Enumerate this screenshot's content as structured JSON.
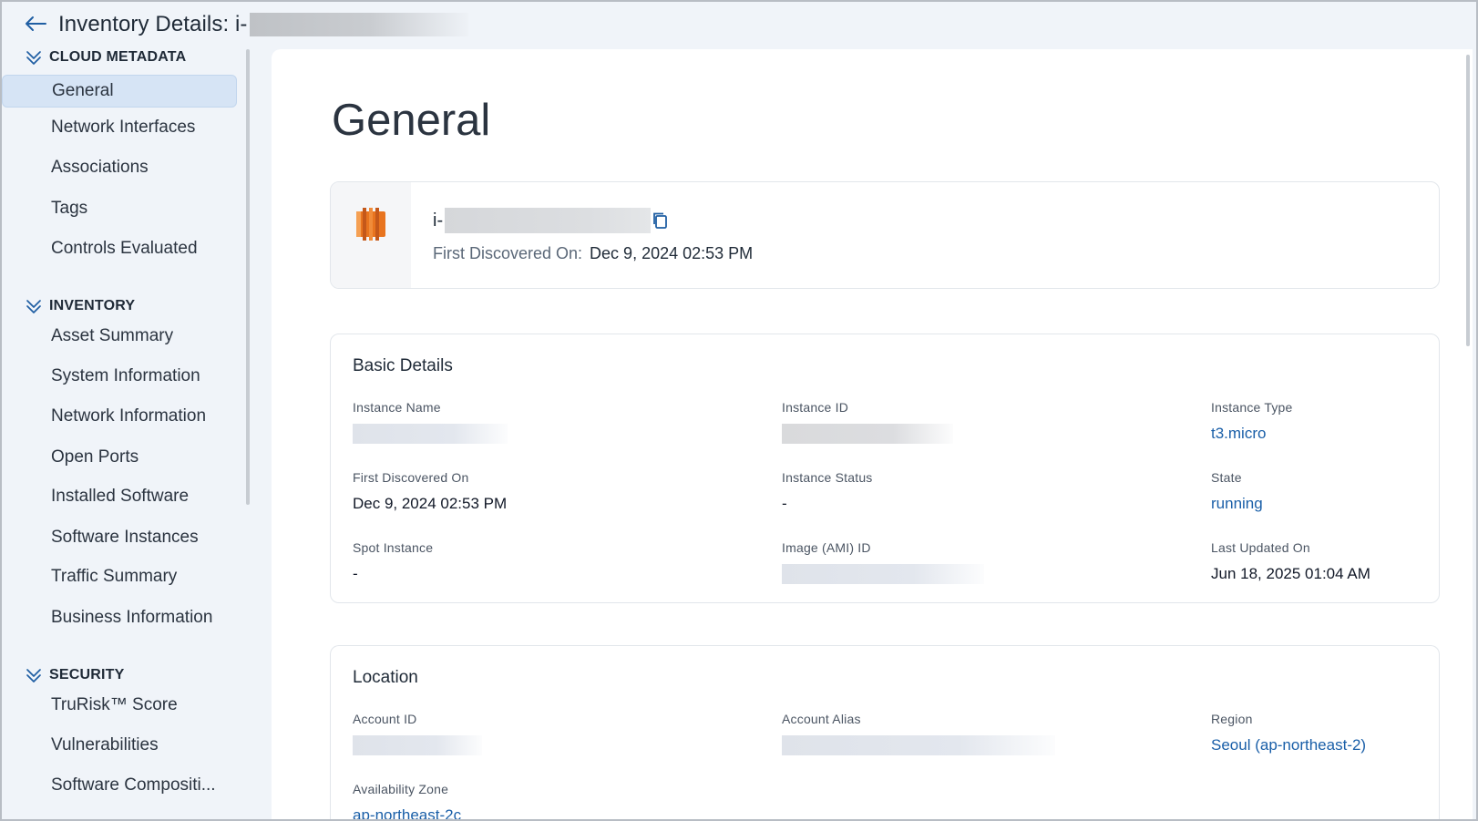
{
  "header": {
    "title": "Inventory Details: i-"
  },
  "sidebar": {
    "sections": [
      {
        "heading": "CLOUD METADATA",
        "items": [
          "General",
          "Network Interfaces",
          "Associations",
          "Tags",
          "Controls Evaluated"
        ]
      },
      {
        "heading": "INVENTORY",
        "items": [
          "Asset Summary",
          "System Information",
          "Network Information",
          "Open Ports",
          "Installed Software",
          "Software Instances",
          "Traffic Summary",
          "Business Information"
        ]
      },
      {
        "heading": "SECURITY",
        "items": [
          "TruRisk™ Score",
          "Vulnerabilities",
          "Software Compositi..."
        ]
      }
    ],
    "active_item": "General"
  },
  "main": {
    "title": "General",
    "instance_card": {
      "instance_prefix": "i-",
      "first_discovered_label": "First Discovered On:",
      "first_discovered_value": "Dec 9, 2024 02:53 PM"
    },
    "basic_details": {
      "title": "Basic Details",
      "fields": {
        "instance_name": {
          "label": "Instance Name",
          "value": ""
        },
        "instance_id": {
          "label": "Instance ID",
          "value": ""
        },
        "instance_type": {
          "label": "Instance Type",
          "value": "t3.micro"
        },
        "first_discovered": {
          "label": "First Discovered On",
          "value": "Dec 9, 2024 02:53 PM"
        },
        "instance_status": {
          "label": "Instance Status",
          "value": "-"
        },
        "state": {
          "label": "State",
          "value": "running"
        },
        "spot_instance": {
          "label": "Spot Instance",
          "value": "-"
        },
        "image_id": {
          "label": "Image (AMI) ID",
          "value": ""
        },
        "last_updated": {
          "label": "Last Updated On",
          "value": "Jun 18, 2025 01:04 AM"
        }
      }
    },
    "location": {
      "title": "Location",
      "fields": {
        "account_id": {
          "label": "Account ID",
          "value": ""
        },
        "account_alias": {
          "label": "Account Alias",
          "value": ""
        },
        "region": {
          "label": "Region",
          "value": "Seoul (ap-northeast-2)"
        },
        "availability_zone": {
          "label": "Availability Zone",
          "value": "ap-northeast-2c"
        }
      }
    }
  },
  "colors": {
    "link": "#1a5fa8",
    "active_nav_bg": "#d6e4f5",
    "aws_orange": "#e8741f",
    "sidebar_bg": "#f0f4f9"
  },
  "icons": {
    "back": "arrow-left-icon",
    "collapse": "chevron-double-down-icon",
    "service": "aws-ec2-icon",
    "copy": "copy-icon"
  }
}
